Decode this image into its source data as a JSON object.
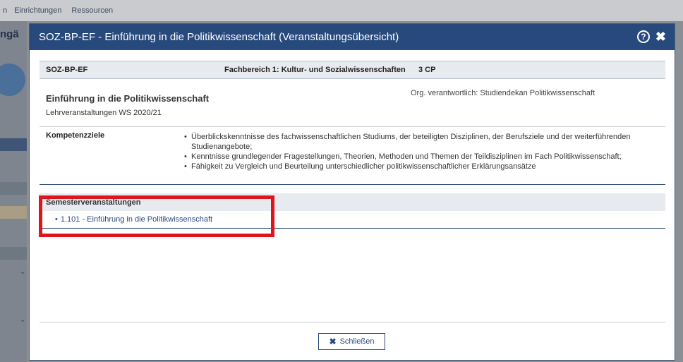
{
  "background": {
    "menu": [
      "n",
      "Einrichtungen",
      "Ressourcen"
    ],
    "left_title": "ngä"
  },
  "dialog": {
    "title": "SOZ-BP-EF - Einführung in die Politikwissenschaft (Veranstaltungsübersicht)",
    "help_icon": "?",
    "close_icon": "✖"
  },
  "module": {
    "code": "SOZ-BP-EF",
    "fachbereich": "Fachbereich 1: Kultur- und Sozialwissenschaften",
    "cp": "3 CP",
    "name": "Einführung in die Politikwissenschaft",
    "semester": "Lehrveranstaltungen WS 2020/21",
    "org": "Org. verantwortlich: Studiendekan Politikwissenschaft"
  },
  "kompetenzziele": {
    "label": "Kompetenzziele",
    "items": [
      "Überblickskenntnisse des fachwissenschaftlichen Studiums, der beteiligten Disziplinen, der Berufsziele und der weiterführenden Studienangebote;",
      "Kenntnisse grundlegender Fragestellungen, Theorien, Methoden und Themen der Teildisziplinen im Fach Politikwissenschaft;",
      "Fähigkeit zu Vergleich und Beurteilung unterschiedlicher politikwissenschaftlicher Erklärungsansätze"
    ]
  },
  "semesterveranstaltungen": {
    "label": "Semesterveranstaltungen",
    "items": [
      "1.101 - Einführung in die Politikwissenschaft"
    ]
  },
  "footer": {
    "close_label": "Schließen"
  }
}
